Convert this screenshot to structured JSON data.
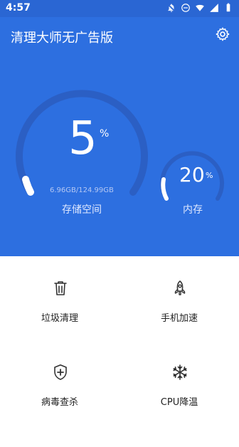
{
  "status_bar": {
    "time": "4:57"
  },
  "header": {
    "title": "清理大师无广告版"
  },
  "storage": {
    "percent": "5",
    "percent_sign": "%",
    "size_text": "6.96GB/124.99GB",
    "label": "存储空间"
  },
  "memory": {
    "percent": "20",
    "percent_sign": "%",
    "label": "内存"
  },
  "actions": [
    {
      "label": "垃圾清理",
      "icon": "trash-icon"
    },
    {
      "label": "手机加速",
      "icon": "rocket-icon"
    },
    {
      "label": "病毒查杀",
      "icon": "shield-plus-icon"
    },
    {
      "label": "CPU降温",
      "icon": "snowflake-icon"
    }
  ],
  "colors": {
    "primary": "#2d6fe0",
    "primary_dark": "#2a66d3",
    "gauge_track": "#2b5fc4",
    "panel_bg": "#ffffff"
  }
}
